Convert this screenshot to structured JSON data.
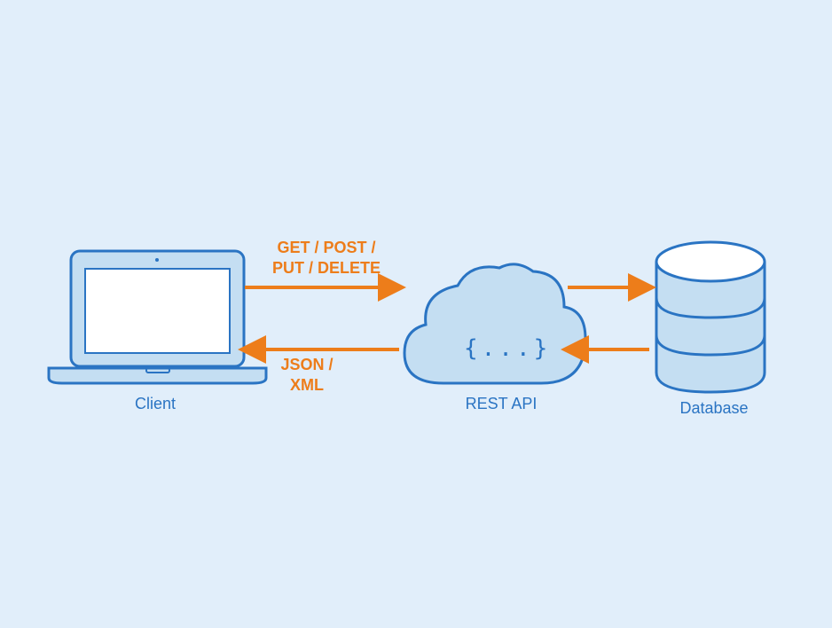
{
  "nodes": {
    "client": {
      "label": "Client"
    },
    "api": {
      "label": "REST API",
      "glyph": "{...}"
    },
    "database": {
      "label": "Database"
    }
  },
  "arrows": {
    "request": {
      "label_line1": "GET / POST /",
      "label_line2": "PUT / DELETE"
    },
    "response": {
      "label_line1": "JSON /",
      "label_line2": "XML"
    }
  },
  "colors": {
    "stroke": "#2a74c3",
    "fill_light": "#c4def2",
    "fill_white": "#ffffff",
    "arrow": "#ed7d1a",
    "bg": "#e1eefa"
  }
}
